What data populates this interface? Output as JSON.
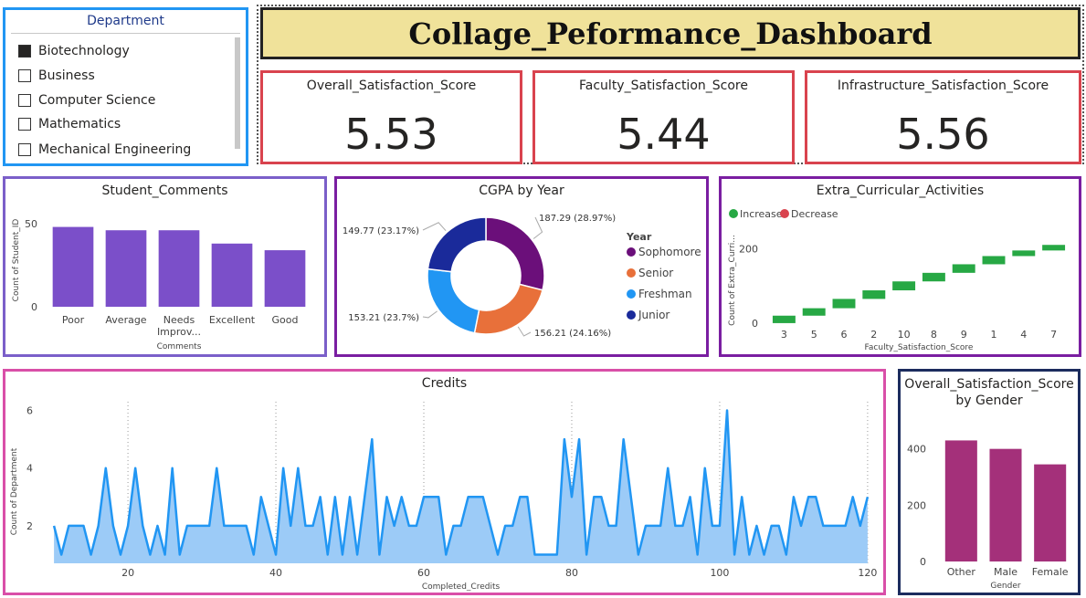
{
  "dashboard_title": "Collage_Peformance_Dashboard",
  "slicer": {
    "title": "Department",
    "items": [
      {
        "label": "Biotechnology",
        "checked": true
      },
      {
        "label": "Business",
        "checked": false
      },
      {
        "label": "Computer Science",
        "checked": false
      },
      {
        "label": "Mathematics",
        "checked": false
      },
      {
        "label": "Mechanical Engineering",
        "checked": false
      }
    ]
  },
  "cards": [
    {
      "label": "Overall_Satisfaction_Score",
      "value": "5.53"
    },
    {
      "label": "Faculty_Satisfaction_Score",
      "value": "5.44"
    },
    {
      "label": "Infrastructure_Satisfaction_Score",
      "value": "5.56"
    }
  ],
  "colors": {
    "purple_bar": "#7b4fc9",
    "credits_line": "#2196f3",
    "credits_fill": "#9ccbf7",
    "gender_bar": "#a4307a",
    "increase": "#27a844",
    "decrease": "#d9434e"
  },
  "chart_data": [
    {
      "type": "bar",
      "title": "Student_Comments",
      "xlabel": "Comments",
      "ylabel": "Count of Student_ID",
      "categories": [
        "Poor",
        "Average",
        "Needs Improv...",
        "Excellent",
        "Good"
      ],
      "values": [
        48,
        46,
        46,
        38,
        34
      ],
      "yticks": [
        0,
        50
      ],
      "ylim": [
        0,
        56
      ]
    },
    {
      "type": "pie",
      "title": "CGPA by Year",
      "legend_title": "Year",
      "series": [
        {
          "name": "Sophomore",
          "value": 187.29,
          "label": "187.29 (28.97%)",
          "color": "#6b0f7a"
        },
        {
          "name": "Senior",
          "value": 156.21,
          "label": "156.21 (24.16%)",
          "color": "#e8703a"
        },
        {
          "name": "Freshman",
          "value": 153.21,
          "label": "153.21 (23.7%)",
          "color": "#2196f3"
        },
        {
          "name": "Junior",
          "value": 149.77,
          "label": "149.77 (23.17%)",
          "color": "#1a2a9a"
        }
      ]
    },
    {
      "type": "bar",
      "title": "Extra_Curricular_Activities",
      "xlabel": "Faculty_Satisfaction_Score",
      "ylabel": "Count of Extra_Curri...",
      "legend": [
        "Increase",
        "Decrease"
      ],
      "categories": [
        "3",
        "5",
        "6",
        "2",
        "10",
        "8",
        "9",
        "1",
        "4",
        "7"
      ],
      "waterfall_steps": [
        [
          0,
          20
        ],
        [
          20,
          40
        ],
        [
          40,
          65
        ],
        [
          65,
          88
        ],
        [
          88,
          112
        ],
        [
          112,
          135
        ],
        [
          135,
          158
        ],
        [
          158,
          180
        ],
        [
          180,
          195
        ],
        [
          195,
          210
        ]
      ],
      "yticks": [
        0,
        200
      ],
      "ylim": [
        -10,
        240
      ]
    },
    {
      "type": "area",
      "title": "Credits",
      "xlabel": "Completed_Credits",
      "ylabel": "Count of Department",
      "xticks": [
        20,
        40,
        60,
        80,
        100,
        120
      ],
      "yticks": [
        2,
        4,
        6
      ],
      "xlim": [
        9,
        121
      ],
      "ylim": [
        0.7,
        6.3
      ],
      "x": [
        10,
        11,
        12,
        13,
        14,
        15,
        16,
        17,
        18,
        19,
        20,
        21,
        22,
        23,
        24,
        25,
        26,
        27,
        28,
        29,
        30,
        31,
        32,
        33,
        34,
        35,
        36,
        37,
        38,
        39,
        40,
        41,
        42,
        43,
        44,
        45,
        46,
        47,
        48,
        49,
        50,
        51,
        52,
        53,
        54,
        55,
        56,
        57,
        58,
        59,
        60,
        61,
        62,
        63,
        64,
        65,
        66,
        67,
        68,
        69,
        70,
        71,
        72,
        73,
        74,
        75,
        76,
        77,
        78,
        79,
        80,
        81,
        82,
        83,
        84,
        85,
        86,
        87,
        88,
        89,
        90,
        91,
        92,
        93,
        94,
        95,
        96,
        97,
        98,
        99,
        100,
        101,
        102,
        103,
        104,
        105,
        106,
        107,
        108,
        109,
        110,
        111,
        112,
        113,
        114,
        115,
        116,
        117,
        118,
        119,
        120
      ],
      "values": [
        2,
        1,
        2,
        2,
        2,
        1,
        2,
        4,
        2,
        1,
        2,
        4,
        2,
        1,
        2,
        1,
        4,
        1,
        2,
        2,
        2,
        2,
        4,
        2,
        2,
        2,
        2,
        1,
        3,
        2,
        1,
        4,
        2,
        4,
        2,
        2,
        3,
        1,
        3,
        1,
        3,
        1,
        3,
        5,
        1,
        3,
        2,
        3,
        2,
        2,
        3,
        3,
        3,
        1,
        2,
        2,
        3,
        3,
        3,
        2,
        1,
        2,
        2,
        3,
        3,
        1,
        1,
        1,
        1,
        5,
        3,
        5,
        1,
        3,
        3,
        2,
        2,
        5,
        3,
        1,
        2,
        2,
        2,
        4,
        2,
        2,
        3,
        1,
        4,
        2,
        2,
        6,
        1,
        3,
        1,
        2,
        1,
        2,
        2,
        1,
        3,
        2,
        3,
        3,
        2,
        2,
        2,
        2,
        3,
        2,
        3
      ]
    },
    {
      "type": "bar",
      "title": "Overall_Satisfaction_Score by Gender",
      "xlabel": "Gender",
      "categories": [
        "Other",
        "Male",
        "Female"
      ],
      "values": [
        430,
        400,
        345
      ],
      "yticks": [
        0,
        200,
        400
      ],
      "ylim": [
        0,
        480
      ]
    }
  ]
}
